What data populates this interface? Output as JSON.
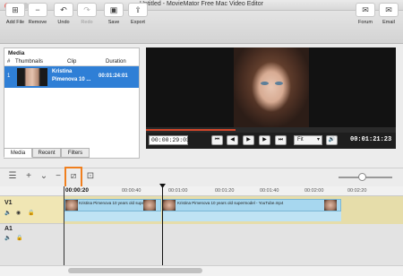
{
  "window": {
    "title": "Untitled - MovieMator Free Mac Video Editor"
  },
  "toolbar": {
    "add_file": "Add File",
    "remove": "Remove",
    "undo": "Undo",
    "redo": "Redo",
    "save": "Save",
    "export": "Export",
    "forum": "Forum",
    "email": "Email"
  },
  "media": {
    "title": "Media",
    "columns": [
      "#",
      "Thumbnails",
      "Clip",
      "Duration"
    ],
    "rows": [
      {
        "num": "1",
        "clip_line1": "Kristina",
        "clip_line2": "Pimenova 10 ...",
        "duration": "00:01:24:01"
      }
    ],
    "tabs": [
      "Media",
      "Recent",
      "Filters"
    ]
  },
  "player": {
    "current_time": "00:00:29:03",
    "zoom": "Fit",
    "total_time": "00:01:21:23",
    "progress": 0.36
  },
  "timeline": {
    "ruler_labels": [
      "00:00:20",
      "00:00:40",
      "00:01:00",
      "00:01:20",
      "00:01:40",
      "00:02:00",
      "00:02:20",
      "00:02:40"
    ],
    "current_mark": "00:00:20",
    "v1_label": "V1",
    "a1_label": "A1",
    "clip_titles": [
      "Kristina Pimenova 10 years old supermodel - YouTube.mp4",
      "Kristina Pimenova 10 years old supermodel - YouTube.mp4"
    ]
  },
  "colors": {
    "accent": "#2f7fd6",
    "highlight": "#f07f1e",
    "scrub": "#d2462a",
    "clip": "#a7d7ef"
  }
}
